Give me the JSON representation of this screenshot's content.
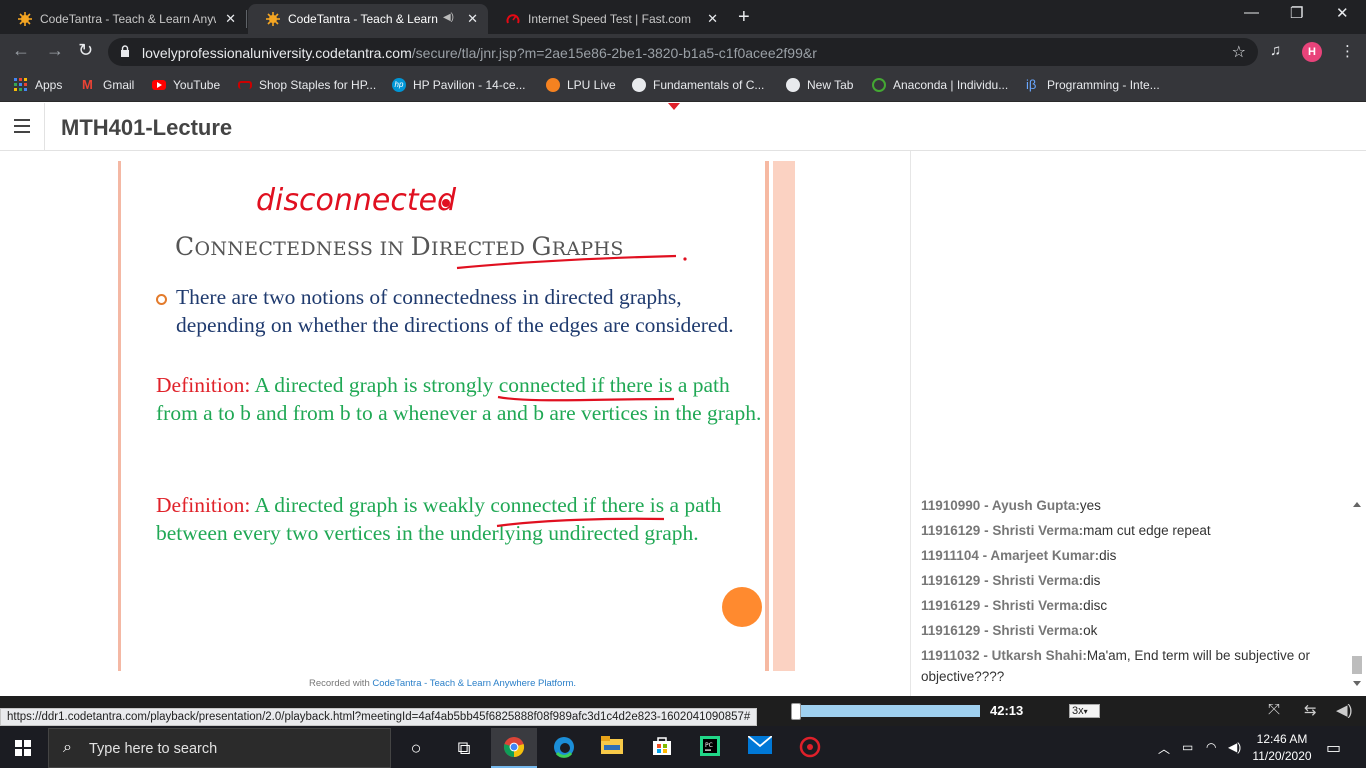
{
  "browser": {
    "tabs": [
      {
        "title": "CodeTantra - Teach & Learn Anyw",
        "active": false
      },
      {
        "title": "CodeTantra - Teach & Learn",
        "active": true
      },
      {
        "title": "Internet Speed Test | Fast.com",
        "active": false
      }
    ],
    "url_domain": "lovelyprofessionaluniversity.codetantra.com",
    "url_path": "/secure/tla/jnr.jsp?m=2ae15e86-2be1-3820-b1a5-c1f0acee2f99&r",
    "profile_initial": "H",
    "bookmarks": [
      "Apps",
      "Gmail",
      "YouTube",
      "Shop Staples for HP...",
      "HP Pavilion - 14-ce...",
      "LPU Live",
      "Fundamentals of C...",
      "New Tab",
      "Anaconda | Individu...",
      "Programming - Inte..."
    ]
  },
  "app": {
    "title": "MTH401-Lecture"
  },
  "slide": {
    "ink_word": "disconnected",
    "heading_cap1": "C",
    "heading_rest1": "ONNECTEDNESS IN ",
    "heading_cap2": "D",
    "heading_rest2": "IRECTED ",
    "heading_cap3": "G",
    "heading_rest3": "RAPHS",
    "bullet": "There are two notions of connectedness in directed graphs, depending on whether the directions of the edges are considered.",
    "def1_label": "Definition:",
    "def1_text": " A directed graph is strongly connected if there is a path from a to b and from b to a whenever a and b are vertices in the graph.",
    "def2_label": "Definition:",
    "def2_text": " A directed graph is weakly connected if there is a path between every two vertices in the underlying undirected graph.",
    "recorded_prefix": "Recorded with ",
    "recorded_link": "CodeTantra - Teach & Learn Anywhere Platform."
  },
  "chat": {
    "messages": [
      {
        "sender": "11910990 - Ayush Gupta:",
        "text": "yes"
      },
      {
        "sender": "11916129 - Shristi Verma:",
        "text": "mam cut edge repeat"
      },
      {
        "sender": "11911104 - Amarjeet Kumar:",
        "text": "dis"
      },
      {
        "sender": "11916129 - Shristi Verma:",
        "text": "dis"
      },
      {
        "sender": "11916129 - Shristi Verma:",
        "text": "disc"
      },
      {
        "sender": "11916129 - Shristi Verma:",
        "text": "ok"
      },
      {
        "sender": "11911032 - Utkarsh Shahi:",
        "text": "Ma'am, End term will be subjective or objective????"
      }
    ]
  },
  "player": {
    "status_url": "https://ddr1.codetantra.com/playback/presentation/2.0/playback.html?meetingId=4af4ab5bb45f6825888f08f989afc3d1c4d2e823-1602041090857#",
    "time": "42:13",
    "speed": "3x"
  },
  "taskbar": {
    "search_placeholder": "Type here to search",
    "time": "12:46 AM",
    "date": "11/20/2020"
  }
}
